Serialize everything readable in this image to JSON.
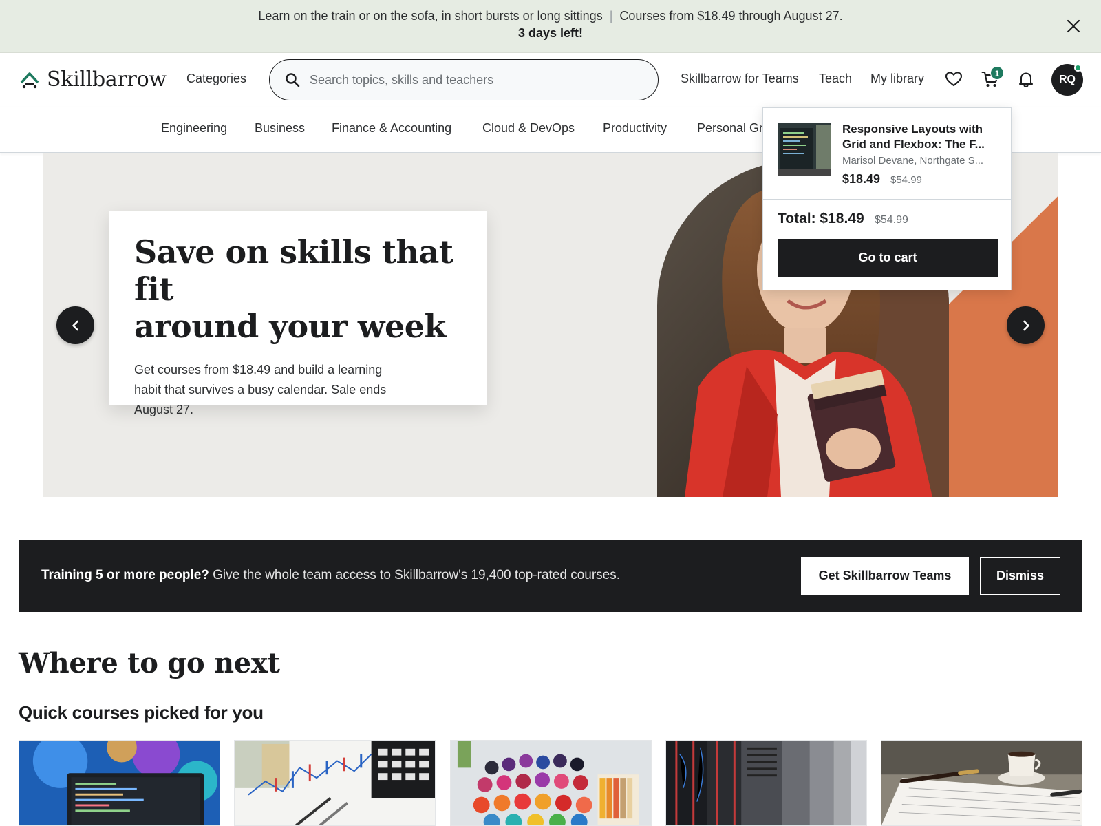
{
  "promo": {
    "message": "Learn on the train or on the sofa, in short bursts or long sittings",
    "separator": "|",
    "offer": "Courses from $18.49 through August 27.",
    "countdown": "3 days left!"
  },
  "header": {
    "logo_text": "Skillbarrow",
    "categories_label": "Categories",
    "search_placeholder": "Search topics, skills and teachers",
    "links": {
      "teams": "Skillbarrow for Teams",
      "teach": "Teach",
      "library": "My library"
    },
    "cart_count": "1",
    "avatar_initials": "RQ"
  },
  "category_bar": {
    "items": [
      "Engineering",
      "Business",
      "Finance & Accounting",
      "Cloud & DevOps",
      "Productivity",
      "Personal Gr"
    ]
  },
  "hero": {
    "title_line1": "Save on skills that fit",
    "title_line2": "around your week",
    "text": "Get courses from $18.49 and build a learning habit that survives a busy calendar. Sale ends August 27."
  },
  "cart_popover": {
    "item_title": "Responsive Layouts with Grid and Flexbox: The F...",
    "item_author": "Marisol Devane, Northgate S...",
    "item_price": "$18.49",
    "item_old_price": "$54.99",
    "total_label": "Total: $18.49",
    "total_old": "$54.99",
    "go_to_cart": "Go to cart"
  },
  "teams_bar": {
    "bold": "Training 5 or more people?",
    "text": " Give the whole team access to Skillbarrow's 19,400 top-rated courses.",
    "cta": "Get Skillbarrow Teams",
    "dismiss": "Dismiss"
  },
  "sections": {
    "heading": "Where to go next",
    "subheading": "Quick courses picked for you"
  },
  "course_cards": [
    {
      "icon": "laptop-code-thumbnail"
    },
    {
      "icon": "finance-chart-thumbnail"
    },
    {
      "icon": "thread-spools-thumbnail"
    },
    {
      "icon": "server-rack-thumbnail"
    },
    {
      "icon": "notebook-coffee-thumbnail"
    }
  ],
  "colors": {
    "brand_dark": "#1c1d1f",
    "promo_bg": "#e6ece3",
    "accent_green": "#1e7a5f",
    "hero_orange": "#d9774a"
  }
}
